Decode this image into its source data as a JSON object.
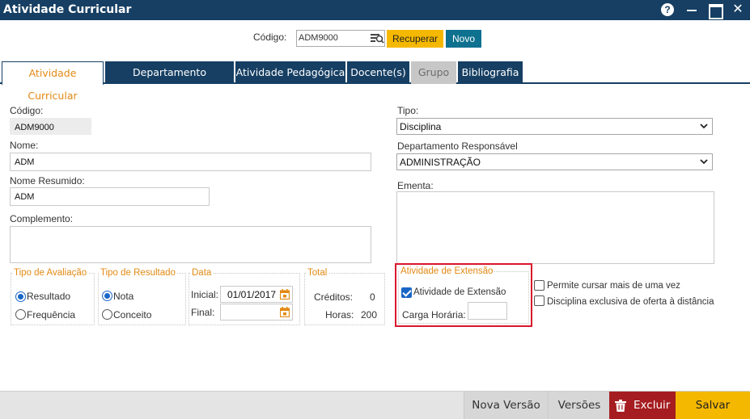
{
  "window": {
    "title": "Atividade Curricular",
    "help_label": "?",
    "close_label": "✕"
  },
  "search": {
    "label": "Código:",
    "value": "ADM9000",
    "recuperar_label": "Recuperar",
    "novo_label": "Novo"
  },
  "tabs": [
    {
      "label": "Atividade Curricular",
      "state": "active"
    },
    {
      "label": "Departamento Autorizado",
      "state": "normal"
    },
    {
      "label": "Atividade Pedagógica",
      "state": "normal"
    },
    {
      "label": "Docente(s)",
      "state": "normal"
    },
    {
      "label": "Grupo",
      "state": "disabled"
    },
    {
      "label": "Bibliografia",
      "state": "normal"
    }
  ],
  "form": {
    "codigo_label": "Código:",
    "codigo_value": "ADM9000",
    "nome_label": "Nome:",
    "nome_value": "ADM",
    "nome_resumido_label": "Nome Resumido:",
    "nome_resumido_value": "ADM",
    "complemento_label": "Complemento:",
    "complemento_value": "",
    "tipo_label": "Tipo:",
    "tipo_value": "Disciplina",
    "departamento_label": "Departamento Responsável",
    "departamento_value": "ADMINISTRAÇÃO",
    "ementa_label": "Ementa:",
    "ementa_value": ""
  },
  "tipo_avaliacao": {
    "title": "Tipo de Avaliação",
    "options": [
      "Resultado",
      "Frequência"
    ],
    "selected": "Resultado"
  },
  "tipo_resultado": {
    "title": "Tipo de Resultado",
    "options": [
      "Nota",
      "Conceito"
    ],
    "selected": "Nota"
  },
  "data": {
    "title": "Data",
    "inicial_label": "Inicial:",
    "inicial_value": "01/01/2017",
    "final_label": "Final:",
    "final_value": ""
  },
  "total": {
    "title": "Total",
    "creditos_label": "Créditos:",
    "creditos_value": "0",
    "horas_label": "Horas:",
    "horas_value": "200"
  },
  "extensao": {
    "title": "Atividade de Extensão",
    "checkbox_label": "Atividade de Extensão",
    "checked": true,
    "carga_label": "Carga Horária:",
    "carga_value": ""
  },
  "options": {
    "permite_label": "Permite cursar mais de uma vez",
    "permite_checked": false,
    "exclusiva_label": "Disciplina exclusiva de oferta à distância",
    "exclusiva_checked": false
  },
  "footer": {
    "nova_versao_label": "Nova Versão",
    "versoes_label": "Versões",
    "excluir_label": "Excluir",
    "salvar_label": "Salvar"
  },
  "colors": {
    "header_navy": "#163f63",
    "accent_orange": "#e38a14",
    "button_yellow": "#f5b800",
    "button_teal": "#0e7190",
    "danger_red": "#a51d20",
    "highlight_red": "#d9172d"
  },
  "icons": [
    "help-icon",
    "minimize-icon",
    "maximize-icon",
    "close-icon",
    "lookup-icon",
    "calendar-icon",
    "chevron-down-icon",
    "trash-icon"
  ]
}
